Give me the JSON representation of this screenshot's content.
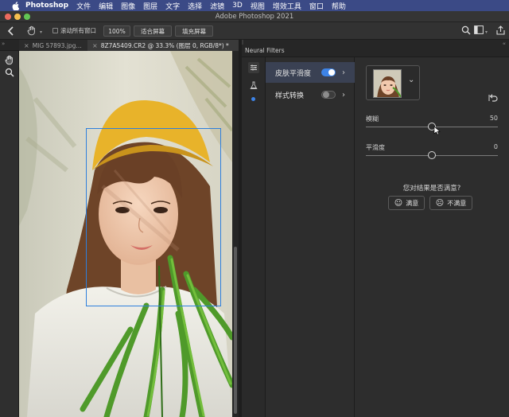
{
  "menubar": {
    "app_name": "Photoshop",
    "items": [
      "文件",
      "编辑",
      "图像",
      "图层",
      "文字",
      "选择",
      "滤镜",
      "3D",
      "视图",
      "增效工具",
      "窗口",
      "帮助"
    ]
  },
  "window": {
    "title": "Adobe Photoshop 2021"
  },
  "options_bar": {
    "scroll_all_label": "滚动所有窗口",
    "zoom_100": "100%",
    "fit_screen": "适合屏幕",
    "fill_screen": "填充屏幕"
  },
  "tabs": [
    {
      "label": "MIG 57893.jpg..."
    },
    {
      "label": "8Z7A5409.CR2 @ 33.3% (图层 0, RGB/8*) *"
    }
  ],
  "neural_filters": {
    "panel_title": "Neural Filters",
    "filters": [
      {
        "label": "皮肤平滑度",
        "enabled": true
      },
      {
        "label": "样式转换",
        "enabled": false
      }
    ],
    "settings": {
      "sliders": [
        {
          "label": "模糊",
          "value": "50",
          "fraction": 0.5
        },
        {
          "label": "平滑度",
          "value": "0",
          "fraction": 0.5
        }
      ],
      "feedback_question": "您对结果是否满意?",
      "yes_label": "满意",
      "no_label": "不满意"
    }
  },
  "colors": {
    "menubar": "#3b4a86",
    "accent_blue": "#3d83e6",
    "face_box": "#2e7fdc",
    "close": "#ed6a5e",
    "minimize": "#f5bf4f",
    "zoom": "#62c554"
  }
}
